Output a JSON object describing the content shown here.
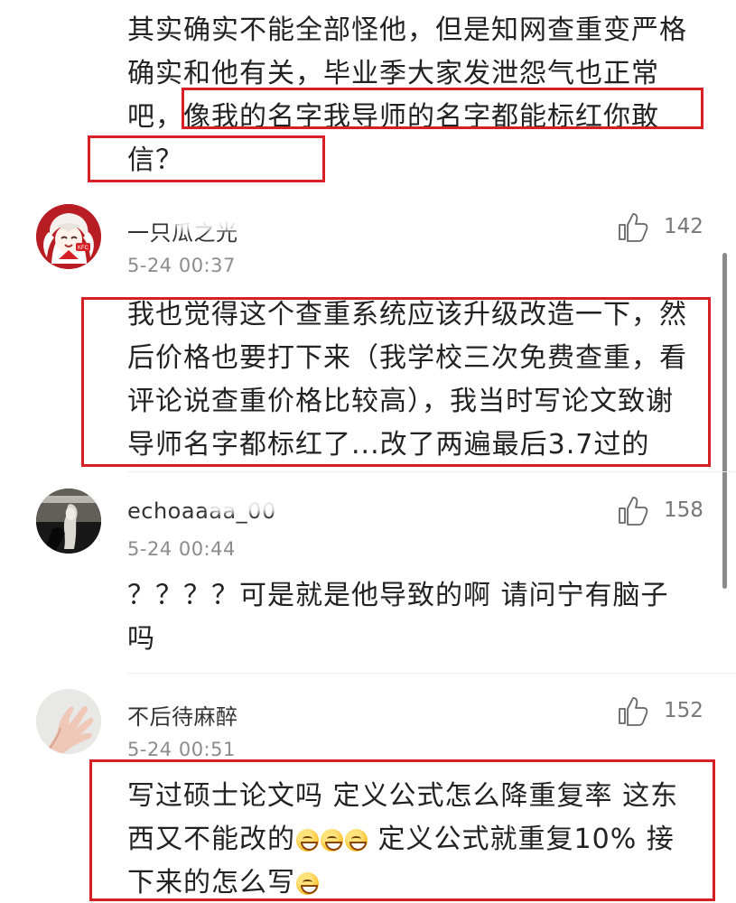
{
  "colors": {
    "highlight_red": "#d91f26",
    "text": "#222222",
    "meta": "#8c8c8c",
    "like": "#777777"
  },
  "top_comment": {
    "line_1": "其实确实不能全部怪他，但是知网查重变严格",
    "line_2": "确实和他有关，毕业季大家发泄怨气也正常",
    "line_3_prefix": "吧，",
    "line_3_highlight": "像我的名字我导师的名字都能标红你敢",
    "line_4_highlight": "信？"
  },
  "comments": [
    {
      "username": "一只瓜之光",
      "time": "5-24 00:37",
      "likes": "142",
      "avatar_icon": "kfc-anime-avatar",
      "lines": [
        "我也觉得这个查重系统应该升级改造一下，然",
        "后价格也要打下来（我学校三次免费查重，看",
        "评论说查重价格比较高），我当时写论文致谢",
        "导师名字都标红了...改了两遍最后3.7过的"
      ]
    },
    {
      "username": "echoaaaa_00",
      "time": "5-24 00:44",
      "likes": "158",
      "avatar_icon": "dark-photo-avatar",
      "lines": [
        "？？？？可是就是他导致的啊   请问宁有脑子",
        "吗"
      ]
    },
    {
      "username": "不后待麻醉",
      "time": "5-24 00:51",
      "likes": "152",
      "avatar_icon": "hand-photo-avatar",
      "lines_1": "写过硕士论文吗 定义公式怎么降重复率 这东",
      "line_2_prefix": "西又不能改的",
      "line_2_suffix": " 定义公式就重复10% 接",
      "line_3_prefix": "下来的怎么写"
    }
  ],
  "icons": {
    "like": "thumbs-up-icon",
    "emoji": "grinning-sweat-emoji"
  }
}
